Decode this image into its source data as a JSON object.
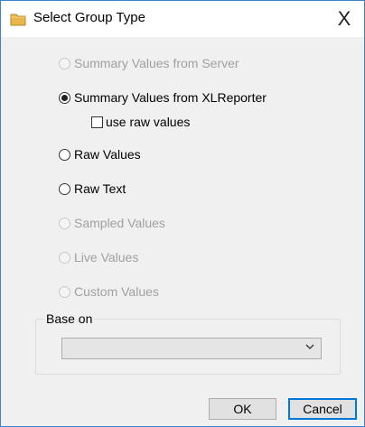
{
  "window": {
    "title": "Select Group Type",
    "close_label": "X"
  },
  "options": [
    {
      "label": "Summary Values from Server",
      "checked": false,
      "enabled": false
    },
    {
      "label": "Summary Values from XLReporter",
      "checked": true,
      "enabled": true
    },
    {
      "label": "Raw Values",
      "checked": false,
      "enabled": true
    },
    {
      "label": "Raw Text",
      "checked": false,
      "enabled": true
    },
    {
      "label": "Sampled Values",
      "checked": false,
      "enabled": false
    },
    {
      "label": "Live Values",
      "checked": false,
      "enabled": false
    },
    {
      "label": "Custom Values",
      "checked": false,
      "enabled": false
    }
  ],
  "raw_values_checkbox": {
    "label": "use raw values",
    "checked": false
  },
  "base_on": {
    "legend": "Base on",
    "selected": "",
    "enabled": false
  },
  "buttons": {
    "ok_label": "OK",
    "cancel_label": "Cancel"
  },
  "colors": {
    "window_border": "#3c82c8",
    "dialog_bg": "#f0f0f0",
    "disabled_text": "#a0a0a0",
    "default_button_border": "#0078d7",
    "folder_icon": "#e8b64a"
  },
  "icons": {
    "title": "folder-icon",
    "combo": "chevron-down-icon"
  }
}
